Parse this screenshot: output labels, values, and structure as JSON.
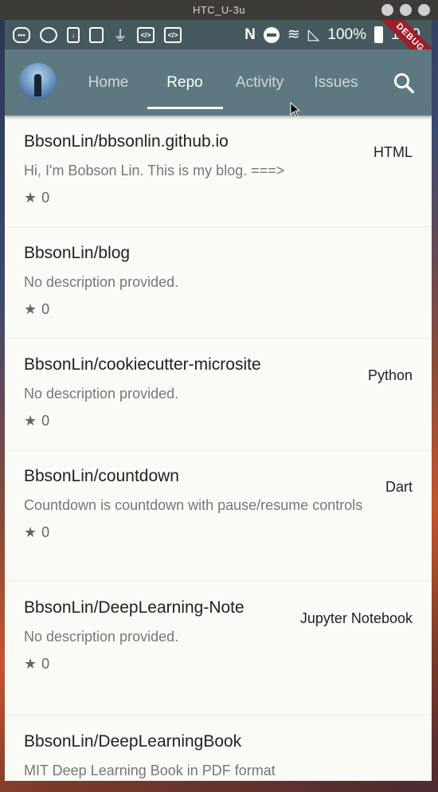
{
  "window": {
    "title": "HTC_U-3u"
  },
  "status_bar": {
    "battery": "100%",
    "time": "1:19"
  },
  "debug_banner": "DEBUG",
  "tabs": [
    {
      "label": "Home"
    },
    {
      "label": "Repo"
    },
    {
      "label": "Activity"
    },
    {
      "label": "Issues"
    }
  ],
  "active_tab": "Repo",
  "repos": [
    {
      "name": "BbsonLin/bbsonlin.github.io",
      "language": "HTML",
      "description": "Hi, I'm Bobson Lin. This is my blog. ===>",
      "stars": "0"
    },
    {
      "name": "BbsonLin/blog",
      "language": "",
      "description": "No description provided.",
      "stars": "0"
    },
    {
      "name": "BbsonLin/cookiecutter-microsite",
      "language": "Python",
      "description": "No description provided.",
      "stars": "0"
    },
    {
      "name": "BbsonLin/countdown",
      "language": "Dart",
      "description": "Countdown is countdown with pause/resume controls",
      "stars": "0"
    },
    {
      "name": "BbsonLin/DeepLearning-Note",
      "language": "Jupyter Notebook",
      "description": "No description provided.",
      "stars": "0"
    },
    {
      "name": "BbsonLin/DeepLearningBook",
      "language": "",
      "description": "MIT Deep Learning Book in PDF format",
      "stars": ""
    }
  ],
  "icons": {
    "star": "★",
    "search": "search-icon"
  }
}
